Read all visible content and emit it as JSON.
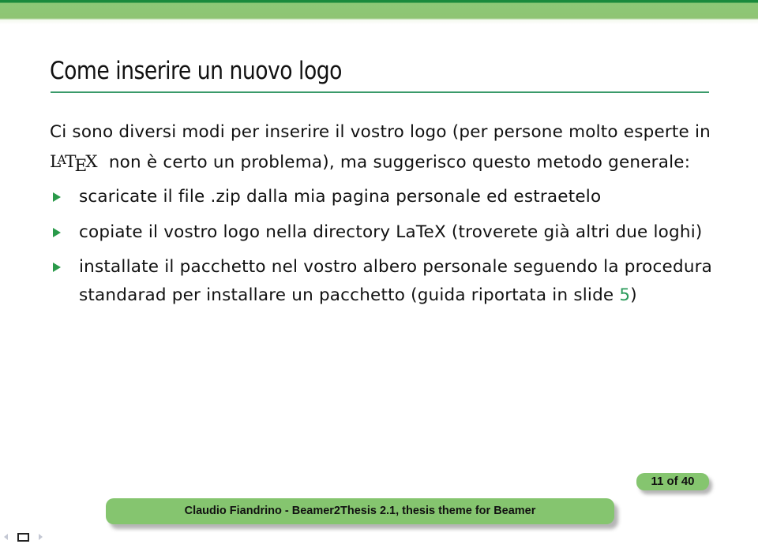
{
  "slide": {
    "title": "Come inserire un nuovo logo",
    "intro": {
      "before_latex": "Ci sono diversi modi per inserire il vostro logo (per persone molto esperte in ",
      "latex_parts": [
        "L",
        "A",
        "T",
        "E",
        "X"
      ],
      "after_latex": "  non è certo un problema), ma suggerisco questo metodo generale:"
    },
    "items": [
      {
        "text": "scaricate il file .zip dalla mia pagina personale ed estraetelo"
      },
      {
        "text": "copiate il vostro logo nella directory LaTeX (troverete già altri due loghi)"
      },
      {
        "text_before": "installate il pacchetto nel vostro albero personale seguendo la procedura standarad per installare un pacchetto (guida riportata in slide ",
        "link": "5",
        "text_after": ")"
      }
    ]
  },
  "footer": {
    "page_indicator": "11 of 40",
    "text": "Claudio Fiandrino - Beamer2Thesis 2.1, thesis theme for Beamer"
  },
  "navigation": {
    "icons": [
      "nav-prev-icon",
      "nav-frame-icon",
      "nav-next-icon"
    ]
  },
  "colors": {
    "header_green": "#8fc474",
    "header_dark_green": "#1a8a3c",
    "rule_green": "#3a9a6a",
    "bullet_green": "#2a9a4a",
    "footer_green": "#85c56f"
  }
}
